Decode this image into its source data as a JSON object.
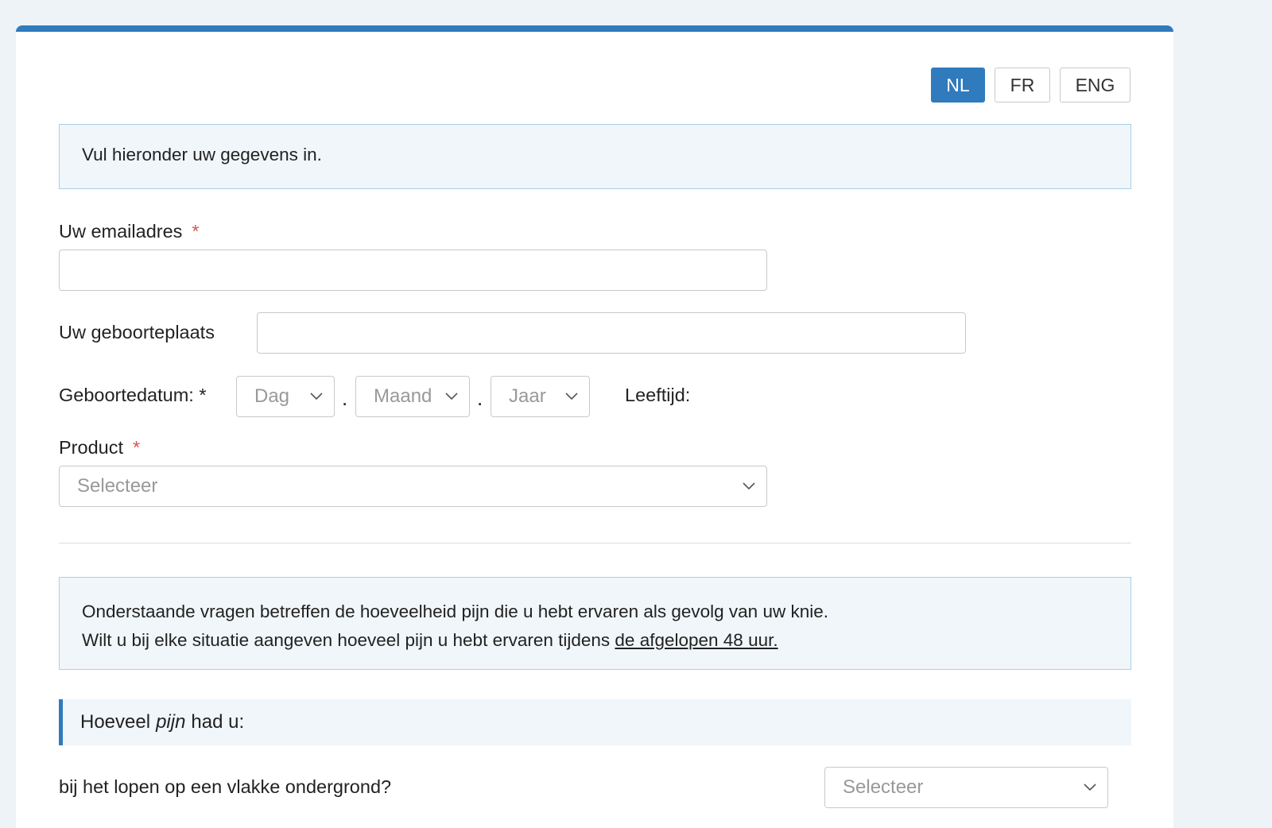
{
  "languages": [
    "NL",
    "FR",
    "ENG"
  ],
  "intro_text": "Vul hieronder uw gegevens in.",
  "form": {
    "email_label": "Uw emailadres",
    "birthplace_label": "Uw geboorteplaats",
    "birthdate_label": "Geboortedatum: *",
    "day_placeholder": "Dag",
    "month_placeholder": "Maand",
    "year_placeholder": "Jaar",
    "date_separator": ".",
    "age_label": "Leeftijd:",
    "product_label": "Product",
    "product_placeholder": "Selecteer",
    "required_marker": "*"
  },
  "info": {
    "line1": "Onderstaande vragen betreffen de hoeveelheid pijn die u hebt ervaren als gevolg van uw knie.",
    "line2_prefix": "Wilt u bij elke situatie aangeven hoeveel pijn u hebt ervaren tijdens ",
    "line2_underlined": "de afgelopen 48 uur."
  },
  "question": {
    "heading_before": "Hoeveel",
    "heading_emphasis": "pijn",
    "heading_after": "had u:",
    "item1": "bij het lopen op een vlakke ondergrond?",
    "item1_placeholder": "Selecteer"
  },
  "colors": {
    "accent": "#2f7bbd",
    "alert_bg": "#f0f6fa",
    "alert_border": "#a9d0e8",
    "required": "#d9534f"
  },
  "icons": {
    "dropdown": "chevron-down-icon"
  }
}
